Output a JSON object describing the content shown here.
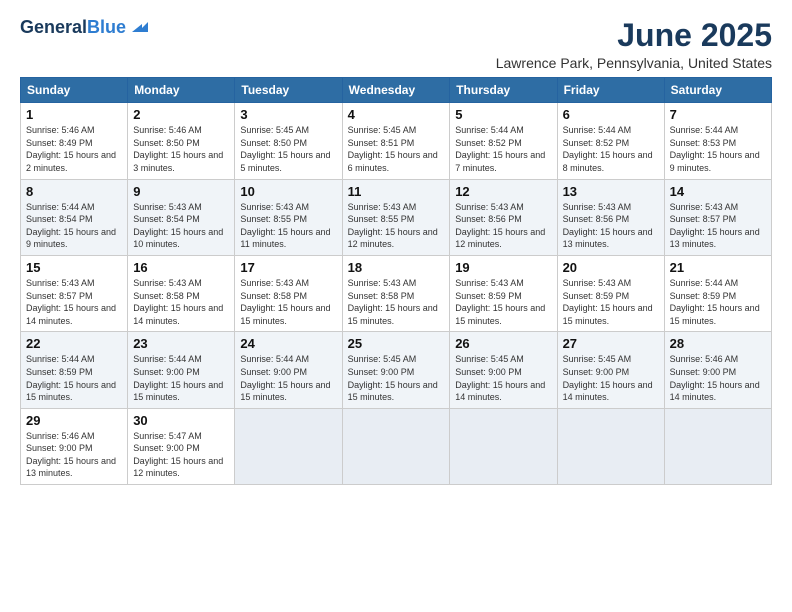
{
  "logo": {
    "line1": "General",
    "line2": "Blue"
  },
  "title": "June 2025",
  "subtitle": "Lawrence Park, Pennsylvania, United States",
  "headers": [
    "Sunday",
    "Monday",
    "Tuesday",
    "Wednesday",
    "Thursday",
    "Friday",
    "Saturday"
  ],
  "weeks": [
    [
      {
        "day": "1",
        "sunrise": "Sunrise: 5:46 AM",
        "sunset": "Sunset: 8:49 PM",
        "daylight": "Daylight: 15 hours and 2 minutes."
      },
      {
        "day": "2",
        "sunrise": "Sunrise: 5:46 AM",
        "sunset": "Sunset: 8:50 PM",
        "daylight": "Daylight: 15 hours and 3 minutes."
      },
      {
        "day": "3",
        "sunrise": "Sunrise: 5:45 AM",
        "sunset": "Sunset: 8:50 PM",
        "daylight": "Daylight: 15 hours and 5 minutes."
      },
      {
        "day": "4",
        "sunrise": "Sunrise: 5:45 AM",
        "sunset": "Sunset: 8:51 PM",
        "daylight": "Daylight: 15 hours and 6 minutes."
      },
      {
        "day": "5",
        "sunrise": "Sunrise: 5:44 AM",
        "sunset": "Sunset: 8:52 PM",
        "daylight": "Daylight: 15 hours and 7 minutes."
      },
      {
        "day": "6",
        "sunrise": "Sunrise: 5:44 AM",
        "sunset": "Sunset: 8:52 PM",
        "daylight": "Daylight: 15 hours and 8 minutes."
      },
      {
        "day": "7",
        "sunrise": "Sunrise: 5:44 AM",
        "sunset": "Sunset: 8:53 PM",
        "daylight": "Daylight: 15 hours and 9 minutes."
      }
    ],
    [
      {
        "day": "8",
        "sunrise": "Sunrise: 5:44 AM",
        "sunset": "Sunset: 8:54 PM",
        "daylight": "Daylight: 15 hours and 9 minutes."
      },
      {
        "day": "9",
        "sunrise": "Sunrise: 5:43 AM",
        "sunset": "Sunset: 8:54 PM",
        "daylight": "Daylight: 15 hours and 10 minutes."
      },
      {
        "day": "10",
        "sunrise": "Sunrise: 5:43 AM",
        "sunset": "Sunset: 8:55 PM",
        "daylight": "Daylight: 15 hours and 11 minutes."
      },
      {
        "day": "11",
        "sunrise": "Sunrise: 5:43 AM",
        "sunset": "Sunset: 8:55 PM",
        "daylight": "Daylight: 15 hours and 12 minutes."
      },
      {
        "day": "12",
        "sunrise": "Sunrise: 5:43 AM",
        "sunset": "Sunset: 8:56 PM",
        "daylight": "Daylight: 15 hours and 12 minutes."
      },
      {
        "day": "13",
        "sunrise": "Sunrise: 5:43 AM",
        "sunset": "Sunset: 8:56 PM",
        "daylight": "Daylight: 15 hours and 13 minutes."
      },
      {
        "day": "14",
        "sunrise": "Sunrise: 5:43 AM",
        "sunset": "Sunset: 8:57 PM",
        "daylight": "Daylight: 15 hours and 13 minutes."
      }
    ],
    [
      {
        "day": "15",
        "sunrise": "Sunrise: 5:43 AM",
        "sunset": "Sunset: 8:57 PM",
        "daylight": "Daylight: 15 hours and 14 minutes."
      },
      {
        "day": "16",
        "sunrise": "Sunrise: 5:43 AM",
        "sunset": "Sunset: 8:58 PM",
        "daylight": "Daylight: 15 hours and 14 minutes."
      },
      {
        "day": "17",
        "sunrise": "Sunrise: 5:43 AM",
        "sunset": "Sunset: 8:58 PM",
        "daylight": "Daylight: 15 hours and 15 minutes."
      },
      {
        "day": "18",
        "sunrise": "Sunrise: 5:43 AM",
        "sunset": "Sunset: 8:58 PM",
        "daylight": "Daylight: 15 hours and 15 minutes."
      },
      {
        "day": "19",
        "sunrise": "Sunrise: 5:43 AM",
        "sunset": "Sunset: 8:59 PM",
        "daylight": "Daylight: 15 hours and 15 minutes."
      },
      {
        "day": "20",
        "sunrise": "Sunrise: 5:43 AM",
        "sunset": "Sunset: 8:59 PM",
        "daylight": "Daylight: 15 hours and 15 minutes."
      },
      {
        "day": "21",
        "sunrise": "Sunrise: 5:44 AM",
        "sunset": "Sunset: 8:59 PM",
        "daylight": "Daylight: 15 hours and 15 minutes."
      }
    ],
    [
      {
        "day": "22",
        "sunrise": "Sunrise: 5:44 AM",
        "sunset": "Sunset: 8:59 PM",
        "daylight": "Daylight: 15 hours and 15 minutes."
      },
      {
        "day": "23",
        "sunrise": "Sunrise: 5:44 AM",
        "sunset": "Sunset: 9:00 PM",
        "daylight": "Daylight: 15 hours and 15 minutes."
      },
      {
        "day": "24",
        "sunrise": "Sunrise: 5:44 AM",
        "sunset": "Sunset: 9:00 PM",
        "daylight": "Daylight: 15 hours and 15 minutes."
      },
      {
        "day": "25",
        "sunrise": "Sunrise: 5:45 AM",
        "sunset": "Sunset: 9:00 PM",
        "daylight": "Daylight: 15 hours and 15 minutes."
      },
      {
        "day": "26",
        "sunrise": "Sunrise: 5:45 AM",
        "sunset": "Sunset: 9:00 PM",
        "daylight": "Daylight: 15 hours and 14 minutes."
      },
      {
        "day": "27",
        "sunrise": "Sunrise: 5:45 AM",
        "sunset": "Sunset: 9:00 PM",
        "daylight": "Daylight: 15 hours and 14 minutes."
      },
      {
        "day": "28",
        "sunrise": "Sunrise: 5:46 AM",
        "sunset": "Sunset: 9:00 PM",
        "daylight": "Daylight: 15 hours and 14 minutes."
      }
    ],
    [
      {
        "day": "29",
        "sunrise": "Sunrise: 5:46 AM",
        "sunset": "Sunset: 9:00 PM",
        "daylight": "Daylight: 15 hours and 13 minutes."
      },
      {
        "day": "30",
        "sunrise": "Sunrise: 5:47 AM",
        "sunset": "Sunset: 9:00 PM",
        "daylight": "Daylight: 15 hours and 12 minutes."
      },
      null,
      null,
      null,
      null,
      null
    ]
  ]
}
